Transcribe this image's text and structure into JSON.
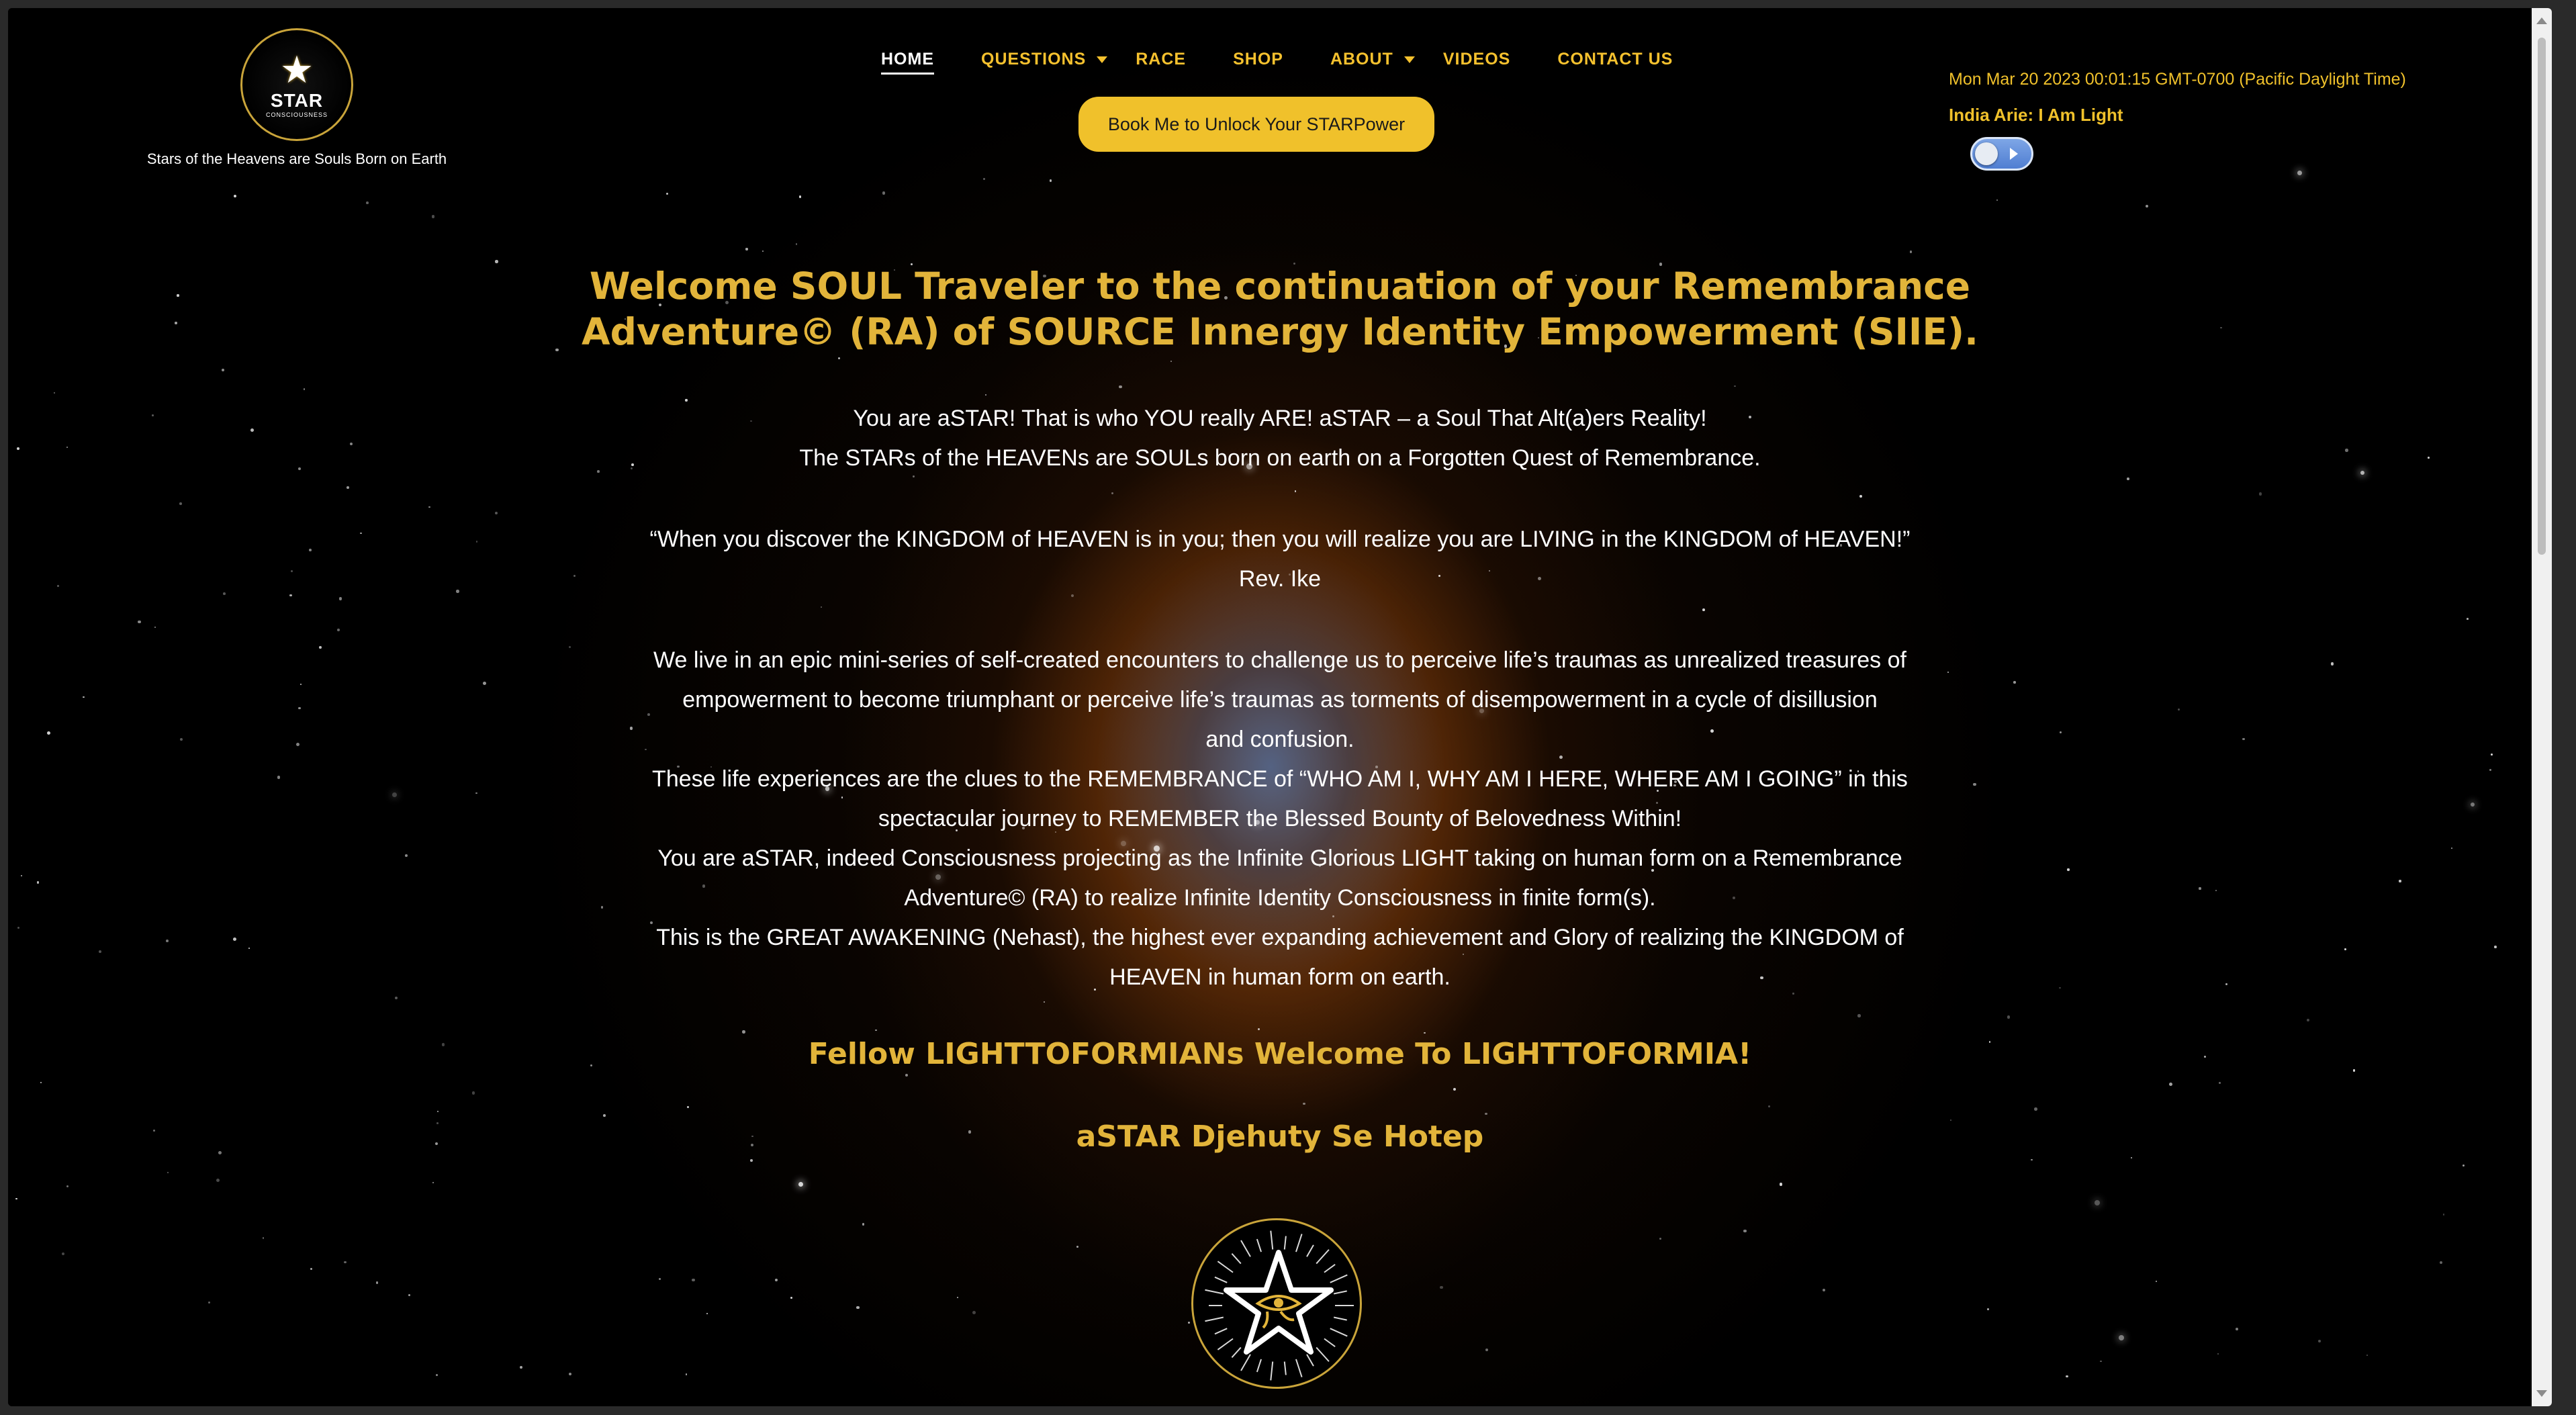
{
  "header": {
    "logo_word": "STAR",
    "logo_sub": "CONSCIOUSNESS",
    "tagline": "Stars of the Heavens are Souls Born on Earth"
  },
  "nav": {
    "items": [
      {
        "label": "HOME"
      },
      {
        "label": "QUESTIONS"
      },
      {
        "label": "RACE"
      },
      {
        "label": "SHOP"
      },
      {
        "label": "ABOUT"
      },
      {
        "label": "VIDEOS"
      },
      {
        "label": "CONTACT US"
      }
    ]
  },
  "cta": {
    "label": "Book Me to Unlock Your STARPower"
  },
  "widget": {
    "clock": "Mon Mar 20 2023 00:01:15 GMT-0700 (Pacific Daylight Time)",
    "song": "India Arie: I Am Light",
    "toggle_state": "off"
  },
  "main": {
    "welcome_lines": [
      "Welcome SOUL Traveler to the continuation of your Remembrance",
      "Adventure© (RA) of SOURCE Innergy Identity Empowerment (SIIE)."
    ],
    "intro_lines": [
      "You are aSTAR! That is who YOU really ARE! aSTAR – a Soul That Alt(a)ers Reality!",
      "The STARs of the HEAVENs are SOULs born on earth on a Forgotten Quest of Remembrance."
    ],
    "quote_lines": [
      "“When you discover the KINGDOM of HEAVEN is in you; then you will realize you are LIVING in the KINGDOM of HEAVEN!”",
      "Rev. Ike"
    ],
    "body_lines": [
      "We live in an epic mini-series of self-created encounters to challenge us to perceive life’s traumas as unrealized treasures of",
      "empowerment to become triumphant or perceive life’s traumas as torments of disempowerment in a cycle of disillusion",
      "and confusion.",
      "These life experiences are the clues to the REMEMBRANCE of “WHO AM I, WHY AM I HERE, WHERE AM I GOING” in this",
      "spectacular journey to REMEMBER the Blessed Bounty of Belovedness Within!",
      "You are aSTAR, indeed Consciousness projecting as the Infinite Glorious LIGHT taking on human form on a Remembrance",
      "Adventure© (RA) to realize Infinite Identity Consciousness in finite form(s).",
      "This is the GREAT AWAKENING (Nehast), the highest ever expanding achievement and Glory of realizing the KINGDOM of",
      "HEAVEN in human form on earth."
    ],
    "fellow": "Fellow LIGHTTOFORMIANs Welcome To LIGHTTOFORMIA!",
    "signoff": "aSTAR Djehuty Se Hotep"
  }
}
